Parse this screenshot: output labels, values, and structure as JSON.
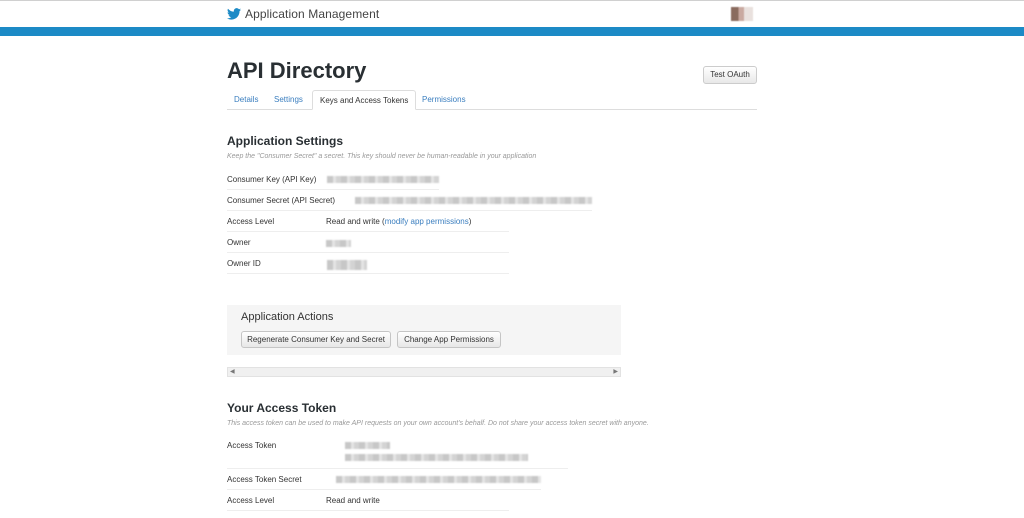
{
  "header": {
    "app_title": "Application Management",
    "logo_icon": "twitter-bird-icon",
    "brand_color": "#1c8ac6"
  },
  "page": {
    "title": "API Directory",
    "test_oauth_label": "Test OAuth"
  },
  "tabs": [
    {
      "label": "Details",
      "active": false
    },
    {
      "label": "Settings",
      "active": false
    },
    {
      "label": "Keys and Access Tokens",
      "active": true
    },
    {
      "label": "Permissions",
      "active": false
    }
  ],
  "app_settings": {
    "heading": "Application Settings",
    "hint": "Keep the \"Consumer Secret\" a secret. This key should never be human-readable in your application",
    "rows": [
      {
        "label": "Consumer Key (API Key)"
      },
      {
        "label": "Consumer Secret (API Secret)"
      },
      {
        "label": "Access Level",
        "value": "Read and write",
        "link": "modify app permissions"
      },
      {
        "label": "Owner"
      },
      {
        "label": "Owner ID"
      }
    ]
  },
  "app_actions": {
    "heading": "Application Actions",
    "regenerate_label": "Regenerate Consumer Key and Secret",
    "change_permissions_label": "Change App Permissions"
  },
  "access_token": {
    "heading": "Your Access Token",
    "hint": "This access token can be used to make API requests on your own account's behalf. Do not share your access token secret with anyone.",
    "rows": [
      {
        "label": "Access Token"
      },
      {
        "label": "Access Token Secret"
      },
      {
        "label": "Access Level",
        "value": "Read and write"
      }
    ]
  }
}
